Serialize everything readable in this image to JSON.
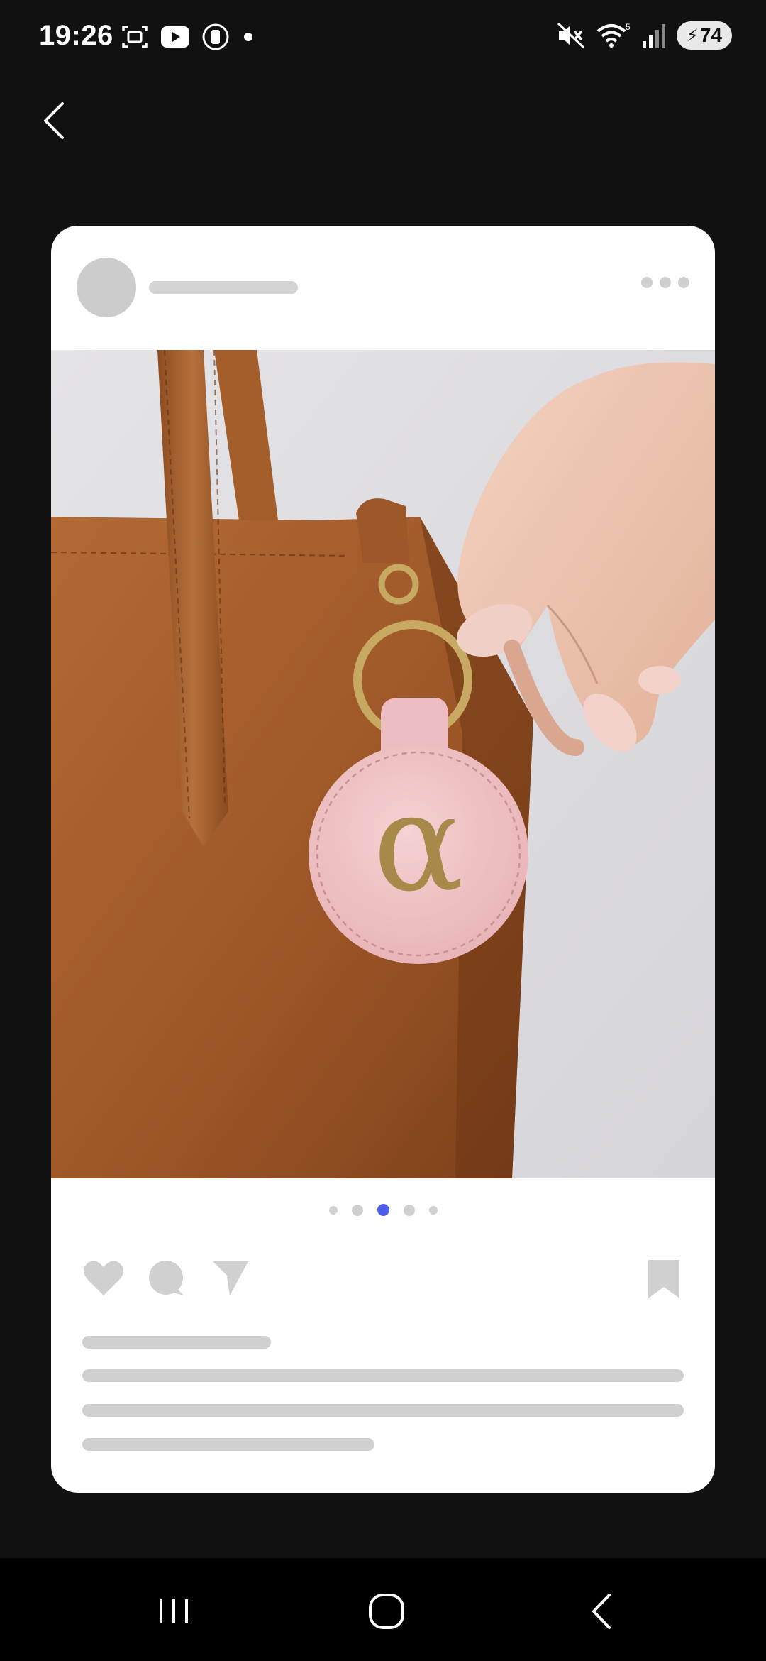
{
  "status_bar": {
    "time": "19:26",
    "battery": "74",
    "left_icons": [
      "screenshot-icon",
      "youtube-icon",
      "watch-icon",
      "notification-dot-icon"
    ],
    "right_icons": [
      "mute-icon",
      "wifi-icon",
      "signal-icon",
      "battery-icon"
    ]
  },
  "toolbar": {
    "back_icon": "chevron-left-icon"
  },
  "post": {
    "image_description_icon": "keychain-photo",
    "monogram": "α",
    "carousel": {
      "count": 5,
      "active_index": 2,
      "active_color": "#4a5ce8"
    },
    "action_icons": [
      "heart-icon",
      "comment-icon",
      "share-icon",
      "bookmark-icon"
    ],
    "placeholder_color": "#d0d0d0"
  },
  "nav_bar": {
    "icons": [
      "recents-icon",
      "home-icon",
      "back-icon"
    ]
  }
}
